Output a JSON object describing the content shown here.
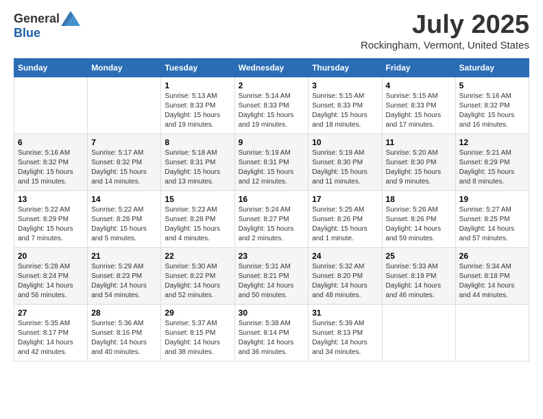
{
  "header": {
    "logo": {
      "text_general": "General",
      "text_blue": "Blue",
      "tagline": "GeneralBlue"
    },
    "month_title": "July 2025",
    "location": "Rockingham, Vermont, United States"
  },
  "days_of_week": [
    "Sunday",
    "Monday",
    "Tuesday",
    "Wednesday",
    "Thursday",
    "Friday",
    "Saturday"
  ],
  "weeks": [
    [
      {
        "day": "",
        "info": ""
      },
      {
        "day": "",
        "info": ""
      },
      {
        "day": "1",
        "info": "Sunrise: 5:13 AM\nSunset: 8:33 PM\nDaylight: 15 hours and 19 minutes."
      },
      {
        "day": "2",
        "info": "Sunrise: 5:14 AM\nSunset: 8:33 PM\nDaylight: 15 hours and 19 minutes."
      },
      {
        "day": "3",
        "info": "Sunrise: 5:15 AM\nSunset: 8:33 PM\nDaylight: 15 hours and 18 minutes."
      },
      {
        "day": "4",
        "info": "Sunrise: 5:15 AM\nSunset: 8:33 PM\nDaylight: 15 hours and 17 minutes."
      },
      {
        "day": "5",
        "info": "Sunrise: 5:16 AM\nSunset: 8:32 PM\nDaylight: 15 hours and 16 minutes."
      }
    ],
    [
      {
        "day": "6",
        "info": "Sunrise: 5:16 AM\nSunset: 8:32 PM\nDaylight: 15 hours and 15 minutes."
      },
      {
        "day": "7",
        "info": "Sunrise: 5:17 AM\nSunset: 8:32 PM\nDaylight: 15 hours and 14 minutes."
      },
      {
        "day": "8",
        "info": "Sunrise: 5:18 AM\nSunset: 8:31 PM\nDaylight: 15 hours and 13 minutes."
      },
      {
        "day": "9",
        "info": "Sunrise: 5:19 AM\nSunset: 8:31 PM\nDaylight: 15 hours and 12 minutes."
      },
      {
        "day": "10",
        "info": "Sunrise: 5:19 AM\nSunset: 8:30 PM\nDaylight: 15 hours and 11 minutes."
      },
      {
        "day": "11",
        "info": "Sunrise: 5:20 AM\nSunset: 8:30 PM\nDaylight: 15 hours and 9 minutes."
      },
      {
        "day": "12",
        "info": "Sunrise: 5:21 AM\nSunset: 8:29 PM\nDaylight: 15 hours and 8 minutes."
      }
    ],
    [
      {
        "day": "13",
        "info": "Sunrise: 5:22 AM\nSunset: 8:29 PM\nDaylight: 15 hours and 7 minutes."
      },
      {
        "day": "14",
        "info": "Sunrise: 5:22 AM\nSunset: 8:28 PM\nDaylight: 15 hours and 5 minutes."
      },
      {
        "day": "15",
        "info": "Sunrise: 5:23 AM\nSunset: 8:28 PM\nDaylight: 15 hours and 4 minutes."
      },
      {
        "day": "16",
        "info": "Sunrise: 5:24 AM\nSunset: 8:27 PM\nDaylight: 15 hours and 2 minutes."
      },
      {
        "day": "17",
        "info": "Sunrise: 5:25 AM\nSunset: 8:26 PM\nDaylight: 15 hours and 1 minute."
      },
      {
        "day": "18",
        "info": "Sunrise: 5:26 AM\nSunset: 8:26 PM\nDaylight: 14 hours and 59 minutes."
      },
      {
        "day": "19",
        "info": "Sunrise: 5:27 AM\nSunset: 8:25 PM\nDaylight: 14 hours and 57 minutes."
      }
    ],
    [
      {
        "day": "20",
        "info": "Sunrise: 5:28 AM\nSunset: 8:24 PM\nDaylight: 14 hours and 56 minutes."
      },
      {
        "day": "21",
        "info": "Sunrise: 5:29 AM\nSunset: 8:23 PM\nDaylight: 14 hours and 54 minutes."
      },
      {
        "day": "22",
        "info": "Sunrise: 5:30 AM\nSunset: 8:22 PM\nDaylight: 14 hours and 52 minutes."
      },
      {
        "day": "23",
        "info": "Sunrise: 5:31 AM\nSunset: 8:21 PM\nDaylight: 14 hours and 50 minutes."
      },
      {
        "day": "24",
        "info": "Sunrise: 5:32 AM\nSunset: 8:20 PM\nDaylight: 14 hours and 48 minutes."
      },
      {
        "day": "25",
        "info": "Sunrise: 5:33 AM\nSunset: 8:19 PM\nDaylight: 14 hours and 46 minutes."
      },
      {
        "day": "26",
        "info": "Sunrise: 5:34 AM\nSunset: 8:18 PM\nDaylight: 14 hours and 44 minutes."
      }
    ],
    [
      {
        "day": "27",
        "info": "Sunrise: 5:35 AM\nSunset: 8:17 PM\nDaylight: 14 hours and 42 minutes."
      },
      {
        "day": "28",
        "info": "Sunrise: 5:36 AM\nSunset: 8:16 PM\nDaylight: 14 hours and 40 minutes."
      },
      {
        "day": "29",
        "info": "Sunrise: 5:37 AM\nSunset: 8:15 PM\nDaylight: 14 hours and 38 minutes."
      },
      {
        "day": "30",
        "info": "Sunrise: 5:38 AM\nSunset: 8:14 PM\nDaylight: 14 hours and 36 minutes."
      },
      {
        "day": "31",
        "info": "Sunrise: 5:39 AM\nSunset: 8:13 PM\nDaylight: 14 hours and 34 minutes."
      },
      {
        "day": "",
        "info": ""
      },
      {
        "day": "",
        "info": ""
      }
    ]
  ]
}
